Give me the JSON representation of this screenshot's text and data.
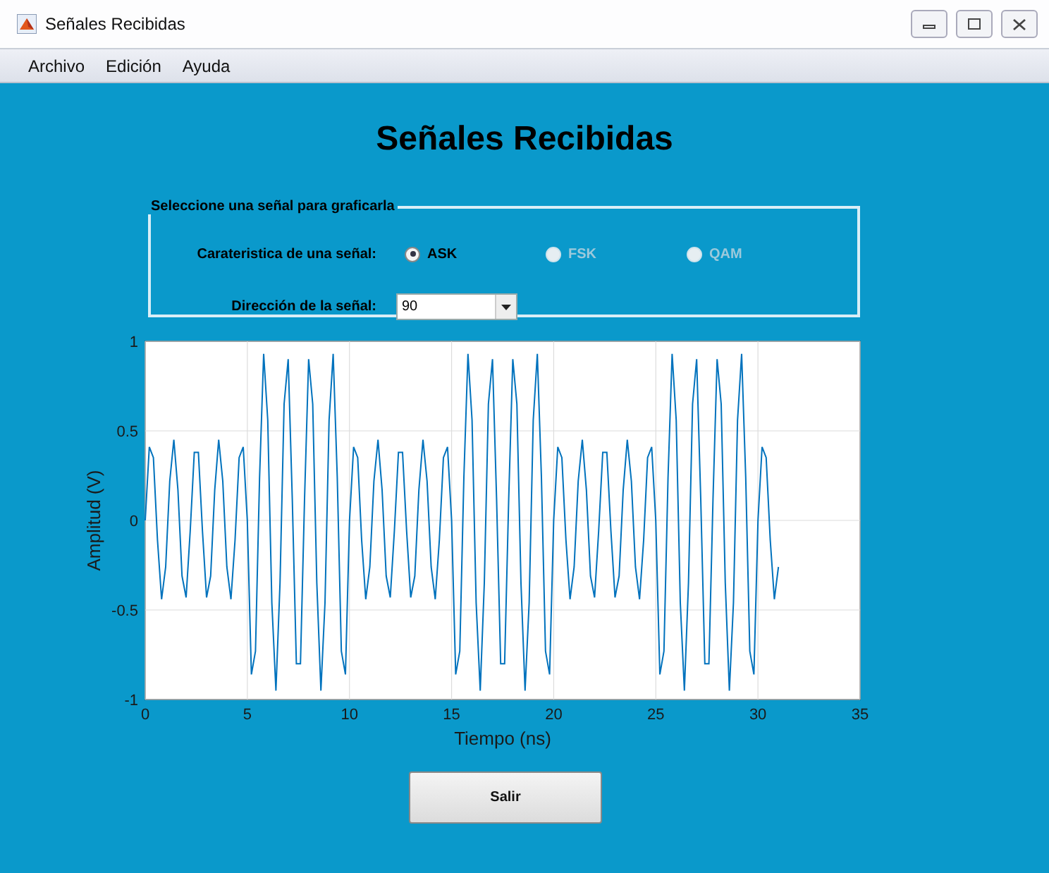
{
  "window": {
    "title": "Señales Recibidas"
  },
  "menu": [
    "Archivo",
    "Edición",
    "Ayuda"
  ],
  "heading": "Señales Recibidas",
  "panel": {
    "title": "Seleccione una señal para graficarla",
    "characteristic": {
      "label": "Carateristica de una señal:",
      "options": [
        {
          "label": "ASK",
          "selected": true,
          "disabled": false
        },
        {
          "label": "FSK",
          "selected": false,
          "disabled": true
        },
        {
          "label": "QAM",
          "selected": false,
          "disabled": true
        }
      ]
    },
    "direction": {
      "label": "Dirección de la señal:",
      "value": "90"
    }
  },
  "plot": {
    "chart_data": {
      "type": "line",
      "grid": true,
      "xlabel": "Tiempo (ns)",
      "ylabel": "Amplitud (V)",
      "xlim": [
        0,
        35
      ],
      "ylim": [
        -1,
        1
      ],
      "xticks": [
        0,
        5,
        10,
        15,
        20,
        25,
        30,
        35
      ],
      "yticks": [
        -1,
        -0.5,
        0,
        0.5,
        1
      ],
      "x": [
        0,
        0.2,
        0.4,
        0.6,
        0.8,
        1,
        1.2,
        1.4,
        1.6,
        1.8,
        2,
        2.2,
        2.4,
        2.6,
        2.8,
        3,
        3.2,
        3.4,
        3.6,
        3.8,
        4,
        4.2,
        4.4,
        4.6,
        4.8,
        5,
        5.2,
        5.4,
        5.6,
        5.8,
        6,
        6.2,
        6.4,
        6.6,
        6.8,
        7,
        7.2,
        7.4,
        7.6,
        7.8,
        8,
        8.2,
        8.4,
        8.6,
        8.8,
        9,
        9.2,
        9.4,
        9.6,
        9.8,
        10,
        10.2,
        10.4,
        10.6,
        10.8,
        11,
        11.2,
        11.4,
        11.6,
        11.8,
        12,
        12.2,
        12.4,
        12.6,
        12.8,
        13,
        13.2,
        13.4,
        13.6,
        13.8,
        14,
        14.2,
        14.4,
        14.6,
        14.8,
        15,
        15.2,
        15.4,
        15.6,
        15.8,
        16,
        16.2,
        16.4,
        16.6,
        16.8,
        17,
        17.2,
        17.4,
        17.6,
        17.8,
        18,
        18.2,
        18.4,
        18.6,
        18.8,
        19,
        19.2,
        19.4,
        19.6,
        19.8,
        20,
        20.2,
        20.4,
        20.6,
        20.8,
        21,
        21.2,
        21.4,
        21.6,
        21.8,
        22,
        22.2,
        22.4,
        22.6,
        22.8,
        23,
        23.2,
        23.4,
        23.6,
        23.8,
        24,
        24.2,
        24.4,
        24.6,
        24.8,
        25,
        25.2,
        25.4,
        25.6,
        25.8,
        26,
        26.2,
        26.4,
        26.6,
        26.8,
        27,
        27.2,
        27.4,
        27.6,
        27.8,
        28,
        28.2,
        28.4,
        28.6,
        28.8,
        29,
        29.2,
        29.4,
        29.6,
        29.8,
        30,
        30.2,
        30.4,
        30.6,
        30.8,
        31
      ],
      "series": [
        {
          "color": "#0072bd",
          "values": [
            0,
            0.41,
            0.35,
            -0.11,
            -0.44,
            -0.26,
            0.22,
            0.45,
            0.17,
            -0.31,
            -0.43,
            -0.06,
            0.38,
            0.38,
            -0.06,
            -0.43,
            -0.31,
            0.17,
            0.45,
            0.22,
            -0.26,
            -0.44,
            -0.11,
            0.35,
            0.41,
            0,
            -0.86,
            -0.73,
            0.24,
            0.93,
            0.56,
            -0.46,
            -0.95,
            -0.35,
            0.65,
            0.9,
            0.12,
            -0.8,
            -0.8,
            0.12,
            0.9,
            0.65,
            -0.35,
            -0.95,
            -0.46,
            0.56,
            0.93,
            0.24,
            -0.73,
            -0.86,
            0,
            0.41,
            0.35,
            -0.11,
            -0.44,
            -0.26,
            0.22,
            0.45,
            0.17,
            -0.31,
            -0.43,
            -0.06,
            0.38,
            0.38,
            -0.06,
            -0.43,
            -0.31,
            0.17,
            0.45,
            0.22,
            -0.26,
            -0.44,
            -0.11,
            0.35,
            0.41,
            0,
            -0.86,
            -0.73,
            0.24,
            0.93,
            0.56,
            -0.46,
            -0.95,
            -0.35,
            0.65,
            0.9,
            0.12,
            -0.8,
            -0.8,
            0.12,
            0.9,
            0.65,
            -0.35,
            -0.95,
            -0.46,
            0.56,
            0.93,
            0.24,
            -0.73,
            -0.86,
            0,
            0.41,
            0.35,
            -0.11,
            -0.44,
            -0.26,
            0.22,
            0.45,
            0.17,
            -0.31,
            -0.43,
            -0.06,
            0.38,
            0.38,
            -0.06,
            -0.43,
            -0.31,
            0.17,
            0.45,
            0.22,
            -0.26,
            -0.44,
            -0.11,
            0.35,
            0.41,
            0,
            -0.86,
            -0.73,
            0.24,
            0.93,
            0.56,
            -0.46,
            -0.95,
            -0.35,
            0.65,
            0.9,
            0.12,
            -0.8,
            -0.8,
            0.12,
            0.9,
            0.65,
            -0.35,
            -0.95,
            -0.46,
            0.56,
            0.93,
            0.24,
            -0.73,
            -0.86,
            0,
            0.41,
            0.35,
            -0.11,
            -0.44,
            -0.26
          ]
        }
      ]
    }
  },
  "buttons": [
    "Salir"
  ]
}
